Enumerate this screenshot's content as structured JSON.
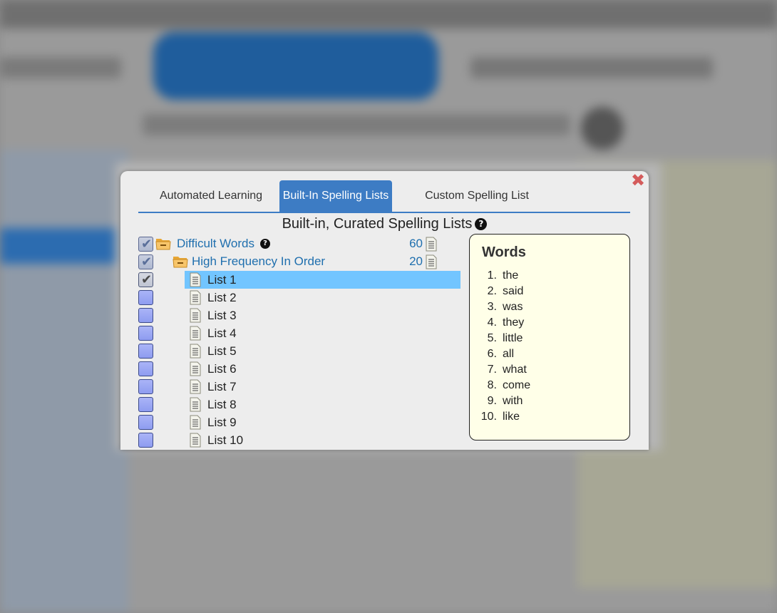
{
  "modal": {
    "close_glyph": "✖",
    "tabs": [
      {
        "label": "Automated Learning",
        "active": false
      },
      {
        "label": "Built-In Spelling Lists",
        "active": true
      },
      {
        "label": "Custom Spelling List",
        "active": false
      }
    ],
    "section_title": "Built-in, Curated Spelling Lists",
    "help_glyph": "?",
    "tree": {
      "folders": [
        {
          "label": "Difficult Words",
          "count": "60",
          "checked": "partial",
          "has_help": true
        },
        {
          "label": "High Frequency In Order",
          "count": "20",
          "checked": "partial",
          "has_help": false
        }
      ],
      "lists": [
        {
          "label": "List 1",
          "checked": true,
          "selected": true
        },
        {
          "label": "List 2",
          "checked": false,
          "selected": false
        },
        {
          "label": "List 3",
          "checked": false,
          "selected": false
        },
        {
          "label": "List 4",
          "checked": false,
          "selected": false
        },
        {
          "label": "List 5",
          "checked": false,
          "selected": false
        },
        {
          "label": "List 6",
          "checked": false,
          "selected": false
        },
        {
          "label": "List 7",
          "checked": false,
          "selected": false
        },
        {
          "label": "List 8",
          "checked": false,
          "selected": false
        },
        {
          "label": "List 9",
          "checked": false,
          "selected": false
        },
        {
          "label": "List 10",
          "checked": false,
          "selected": false
        }
      ]
    },
    "words_panel": {
      "title": "Words",
      "words": [
        {
          "num": "1.",
          "word": "the"
        },
        {
          "num": "2.",
          "word": "said"
        },
        {
          "num": "3.",
          "word": "was"
        },
        {
          "num": "4.",
          "word": "they"
        },
        {
          "num": "5.",
          "word": "little"
        },
        {
          "num": "6.",
          "word": "all"
        },
        {
          "num": "7.",
          "word": "what"
        },
        {
          "num": "8.",
          "word": "come"
        },
        {
          "num": "9.",
          "word": "with"
        },
        {
          "num": "10.",
          "word": "like"
        }
      ]
    }
  },
  "colors": {
    "accent": "#3d7cc4",
    "link": "#1f6fae",
    "selection": "#72c5ff",
    "close": "#d45b5b",
    "words_bg": "#ffffe8"
  },
  "icons": {
    "folder": "folder-open-icon",
    "document": "document-icon",
    "help": "question-circle-icon",
    "close": "close-icon",
    "check": "checkmark-icon"
  }
}
